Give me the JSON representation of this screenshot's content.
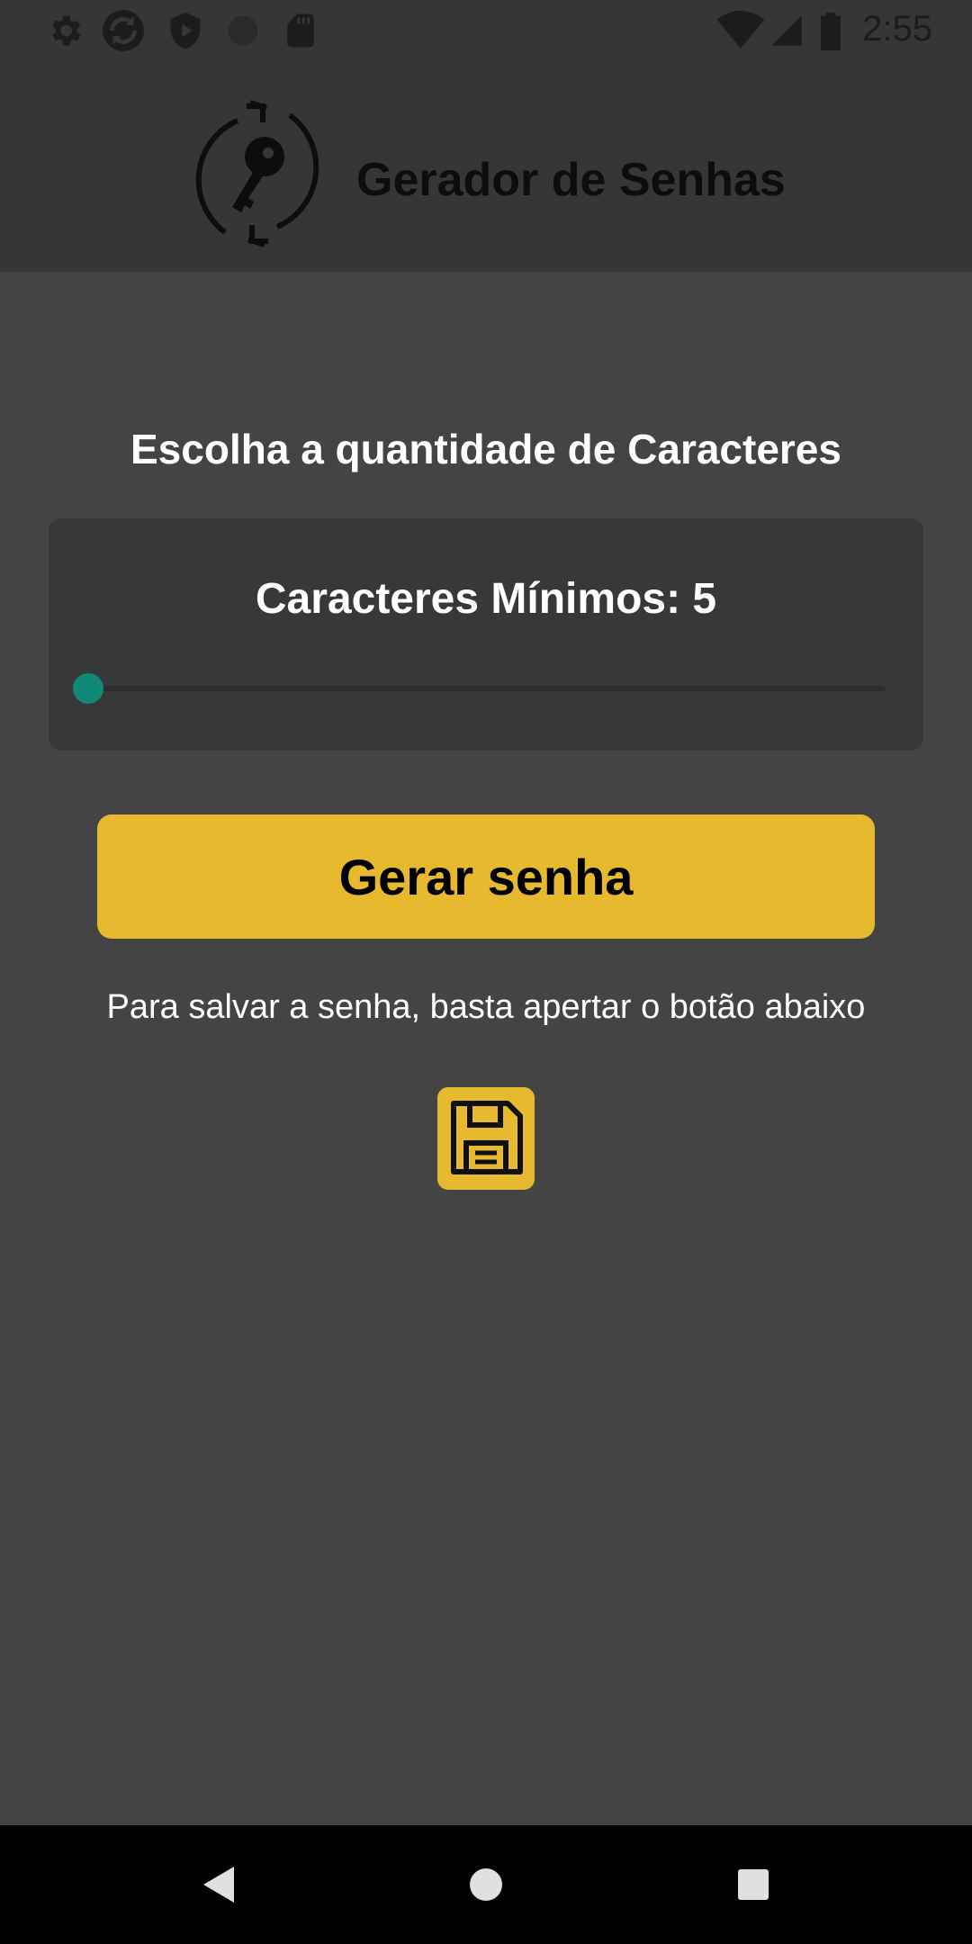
{
  "status_bar": {
    "time": "2:55",
    "icons_left": [
      "settings-icon",
      "sync-icon",
      "shield-play-icon",
      "circle-icon",
      "sd-card-icon"
    ],
    "icons_right": [
      "wifi-icon",
      "signal-icon",
      "battery-icon"
    ]
  },
  "header": {
    "title": "Gerador de Senhas",
    "logo_icon": "key-refresh-icon"
  },
  "main": {
    "section_title": "Escolha a quantidade de Caracteres",
    "slider": {
      "label": "Caracteres Mínimos: 5",
      "value_fraction": 0.0
    },
    "generate_button_label": "Gerar senha",
    "hint_text": "Para salvar a senha, basta apertar o botão abaixo",
    "save_icon": "floppy-disk-icon"
  },
  "nav_bar": {
    "buttons": [
      "back-icon",
      "home-icon",
      "recents-icon"
    ]
  },
  "colors": {
    "background": "#444444",
    "header_background": "#363636",
    "card_background": "#373838",
    "accent": "#e6b92e",
    "slider_thumb": "#0f8a79"
  }
}
